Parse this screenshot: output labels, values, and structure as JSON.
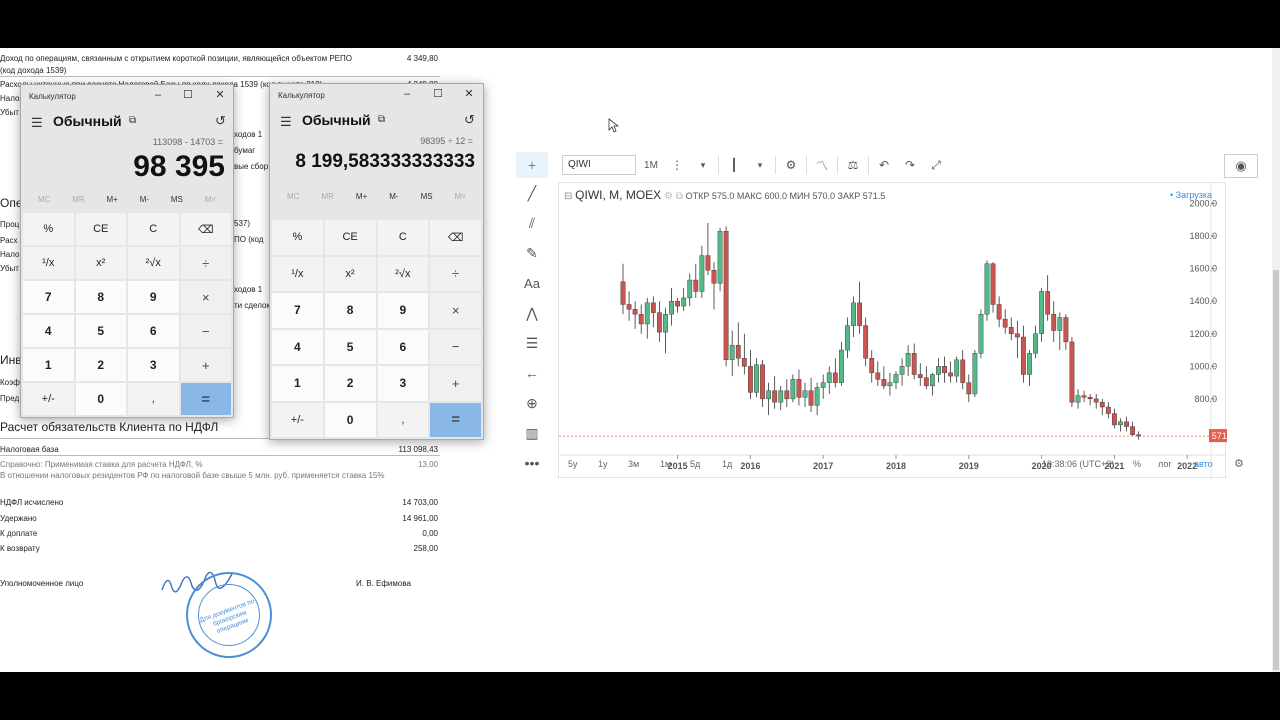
{
  "document": {
    "lines": [
      {
        "text": "Доход по операциям, связанным с открытием короткой позиции, являющейся объектом РЕПО",
        "value": "4 349,80"
      },
      {
        "text": "(код дохода 1539)",
        "value": ""
      },
      {
        "text": "Расходы учтенные при расчете Налоговой Базы по коду дохода 1539 (код вычета 212)",
        "value": "4 349,80"
      },
      {
        "text": "Налог",
        "value": ""
      },
      {
        "text": "Убыт",
        "value": ""
      }
    ],
    "partial_left": [
      "Опе",
      "Проц",
      "Расх",
      "Нало",
      "Убыт",
      "Инв",
      "Коэф",
      "Пред"
    ],
    "partial_right": [
      "ходов 1",
      "бумаг",
      "вые сбор",
      "537)",
      "ПО (код",
      "ходов 1",
      "ти сделок"
    ],
    "section_title": "Расчет обязательств Клиента по НДФЛ",
    "tax_base_label": "Налоговая база",
    "tax_base_value": "113 098,43",
    "rate_label": "Справочно: Применимая ставка для расчета НДФЛ, %",
    "rate_value": "13,00",
    "rate_note": "В отношении налоговых резидентов РФ по налоговой базе свыше 5 млн. руб. применяется ставка 15%",
    "ndfl_label": "НДФЛ исчислено",
    "ndfl_value": "14 703,00",
    "held_label": "Удержано",
    "held_value": "14 961,00",
    "topay_label": "К доплате",
    "topay_value": "0,00",
    "refund_label": "К возврату",
    "refund_value": "258,00",
    "signer_label": "Уполномоченное лицо",
    "signer_name": "И. В. Ефимова",
    "stamp_text": "Для документов по брокерским операциям"
  },
  "calc1": {
    "title": "Калькулятор",
    "mode": "Обычный",
    "expression": "113098 - 14703 =",
    "result": "98 395",
    "memory": [
      "MC",
      "MR",
      "M+",
      "M-",
      "MS",
      "M˅"
    ],
    "keys": [
      "%",
      "CE",
      "C",
      "⌫",
      "¹/x",
      "x²",
      "²√x",
      "÷",
      "7",
      "8",
      "9",
      "×",
      "4",
      "5",
      "6",
      "−",
      "1",
      "2",
      "3",
      "+",
      "+/-",
      "0",
      ",",
      "="
    ]
  },
  "calc2": {
    "title": "Калькулятор",
    "mode": "Обычный",
    "expression": "98395 ÷ 12 =",
    "result": "8 199,583333333333",
    "memory": [
      "MC",
      "MR",
      "M+",
      "M-",
      "MS",
      "M˅"
    ],
    "keys": [
      "%",
      "CE",
      "C",
      "⌫",
      "¹/x",
      "x²",
      "²√x",
      "÷",
      "7",
      "8",
      "9",
      "×",
      "4",
      "5",
      "6",
      "−",
      "1",
      "2",
      "3",
      "+",
      "+/-",
      "0",
      ",",
      "="
    ]
  },
  "chart_widget": {
    "symbol_input": "QIWI",
    "interval": "1М",
    "legend_symbol": "QIWI, M, MOEX",
    "ohlc_text": "ОТКР 575.0 МАКС 600.0 МИН 570.0 ЗАКР 571.5",
    "loading": "• Загрузка",
    "last_price": "571.5",
    "ranges": [
      "5y",
      "1y",
      "3м",
      "1м",
      "5д",
      "1д"
    ],
    "time": "19:38:06 (UTC+3)",
    "percent": "%",
    "log": "лог",
    "auto": "авто",
    "colors": {
      "up": "#53b987",
      "down": "#c95450",
      "accent": "#3c8dde",
      "price_tag": "#e45d50"
    }
  },
  "chart_data": {
    "type": "candlestick",
    "title": "QIWI, M, MOEX",
    "x_labels": [
      "2015",
      "2016",
      "2017",
      "2018",
      "2019",
      "2020",
      "2021",
      "2022"
    ],
    "y_ticks": [
      800,
      1000,
      1200,
      1400,
      1600,
      1800,
      2000
    ],
    "ylim": [
      480,
      2040
    ],
    "x_start_year": 2014.25,
    "series": [
      [
        1520,
        1630,
        1320,
        1380
      ],
      [
        1380,
        1460,
        1280,
        1350
      ],
      [
        1350,
        1400,
        1230,
        1320
      ],
      [
        1320,
        1380,
        1200,
        1260
      ],
      [
        1260,
        1420,
        1170,
        1390
      ],
      [
        1390,
        1430,
        1240,
        1330
      ],
      [
        1330,
        1400,
        1150,
        1210
      ],
      [
        1210,
        1360,
        1080,
        1320
      ],
      [
        1320,
        1480,
        1250,
        1400
      ],
      [
        1400,
        1420,
        1330,
        1370
      ],
      [
        1370,
        1480,
        1340,
        1420
      ],
      [
        1420,
        1570,
        1370,
        1530
      ],
      [
        1530,
        1630,
        1420,
        1460
      ],
      [
        1460,
        1740,
        1420,
        1680
      ],
      [
        1680,
        1880,
        1560,
        1590
      ],
      [
        1590,
        1640,
        1350,
        1510
      ],
      [
        1510,
        1850,
        1460,
        1830
      ],
      [
        1830,
        1860,
        1000,
        1040
      ],
      [
        1040,
        1220,
        940,
        1130
      ],
      [
        1130,
        1270,
        1000,
        1050
      ],
      [
        1050,
        1200,
        950,
        1000
      ],
      [
        1000,
        1100,
        800,
        840
      ],
      [
        840,
        1050,
        810,
        1010
      ],
      [
        1010,
        1040,
        750,
        800
      ],
      [
        800,
        900,
        700,
        850
      ],
      [
        850,
        940,
        740,
        780
      ],
      [
        780,
        880,
        730,
        850
      ],
      [
        850,
        920,
        750,
        800
      ],
      [
        800,
        950,
        780,
        920
      ],
      [
        920,
        980,
        760,
        810
      ],
      [
        810,
        900,
        750,
        850
      ],
      [
        850,
        930,
        720,
        760
      ],
      [
        760,
        900,
        700,
        870
      ],
      [
        870,
        950,
        800,
        900
      ],
      [
        900,
        1000,
        830,
        960
      ],
      [
        960,
        1050,
        870,
        900
      ],
      [
        900,
        1150,
        880,
        1100
      ],
      [
        1100,
        1300,
        1050,
        1250
      ],
      [
        1250,
        1430,
        1180,
        1390
      ],
      [
        1390,
        1520,
        1200,
        1250
      ],
      [
        1250,
        1300,
        1000,
        1050
      ],
      [
        1050,
        1100,
        900,
        960
      ],
      [
        960,
        1030,
        880,
        920
      ],
      [
        920,
        1000,
        860,
        880
      ],
      [
        880,
        960,
        820,
        900
      ],
      [
        900,
        970,
        860,
        950
      ],
      [
        950,
        1050,
        880,
        1000
      ],
      [
        1000,
        1130,
        940,
        1080
      ],
      [
        1080,
        1140,
        920,
        950
      ],
      [
        950,
        1020,
        880,
        930
      ],
      [
        930,
        1000,
        860,
        880
      ],
      [
        880,
        960,
        820,
        950
      ],
      [
        950,
        1050,
        900,
        1000
      ],
      [
        1000,
        1060,
        900,
        960
      ],
      [
        960,
        1030,
        900,
        940
      ],
      [
        940,
        1060,
        900,
        1040
      ],
      [
        1040,
        1100,
        860,
        900
      ],
      [
        900,
        950,
        780,
        830
      ],
      [
        830,
        1100,
        810,
        1080
      ],
      [
        1080,
        1350,
        1050,
        1320
      ],
      [
        1320,
        1650,
        1280,
        1630
      ],
      [
        1630,
        1640,
        1330,
        1380
      ],
      [
        1380,
        1430,
        1240,
        1290
      ],
      [
        1290,
        1350,
        1200,
        1240
      ],
      [
        1240,
        1300,
        1160,
        1200
      ],
      [
        1200,
        1280,
        1050,
        1180
      ],
      [
        1180,
        1250,
        900,
        950
      ],
      [
        950,
        1100,
        880,
        1080
      ],
      [
        1080,
        1250,
        1050,
        1200
      ],
      [
        1200,
        1480,
        1150,
        1460
      ],
      [
        1460,
        1560,
        1280,
        1320
      ],
      [
        1320,
        1400,
        1150,
        1220
      ],
      [
        1220,
        1330,
        1100,
        1300
      ],
      [
        1300,
        1320,
        1100,
        1150
      ],
      [
        1150,
        1180,
        750,
        780
      ],
      [
        780,
        860,
        740,
        820
      ],
      [
        820,
        850,
        780,
        810
      ],
      [
        810,
        830,
        760,
        800
      ],
      [
        800,
        830,
        740,
        780
      ],
      [
        780,
        800,
        700,
        750
      ],
      [
        750,
        780,
        680,
        710
      ],
      [
        710,
        740,
        620,
        640
      ],
      [
        640,
        680,
        600,
        660
      ],
      [
        660,
        690,
        600,
        630
      ],
      [
        630,
        660,
        570,
        580
      ],
      [
        580,
        600,
        550,
        571.5
      ]
    ]
  }
}
